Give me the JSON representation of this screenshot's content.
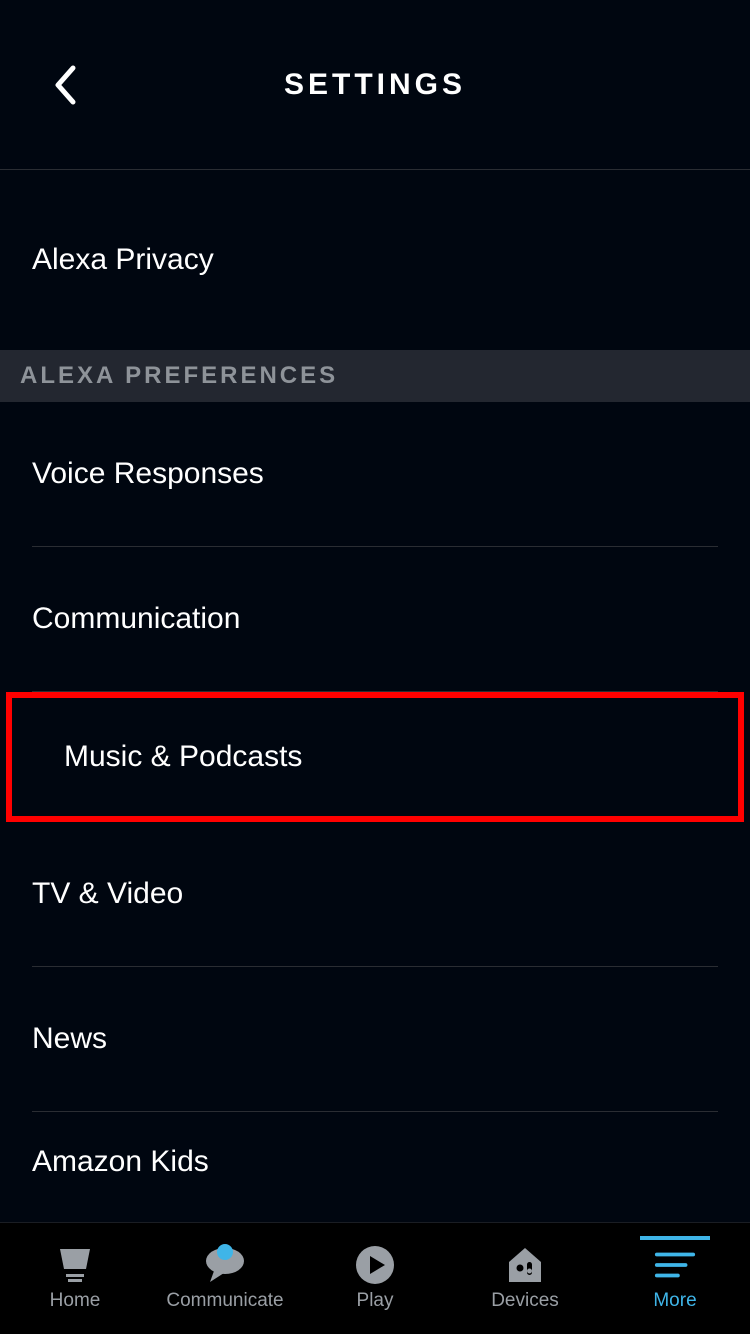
{
  "header": {
    "title": "SETTINGS"
  },
  "sections": {
    "top": {
      "items": [
        {
          "label": "Alexa Privacy"
        }
      ]
    },
    "preferences": {
      "title": "ALEXA PREFERENCES",
      "items": [
        {
          "label": "Voice Responses"
        },
        {
          "label": "Communication"
        },
        {
          "label": "Music & Podcasts",
          "highlighted": true
        },
        {
          "label": "TV & Video"
        },
        {
          "label": "News"
        },
        {
          "label": "Amazon Kids"
        }
      ]
    }
  },
  "nav": {
    "items": [
      {
        "label": "Home"
      },
      {
        "label": "Communicate"
      },
      {
        "label": "Play"
      },
      {
        "label": "Devices"
      },
      {
        "label": "More"
      }
    ]
  }
}
